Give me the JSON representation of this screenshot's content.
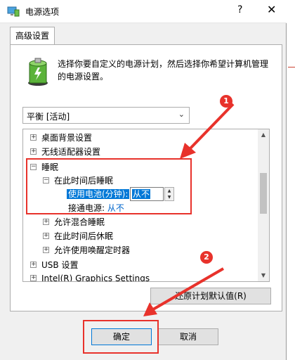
{
  "window": {
    "title": "电源选项",
    "help_symbol": "?",
    "close_symbol": "✕",
    "tab_label": "高级设置"
  },
  "description": "选择你要自定义的电源计划，然后选择你希望计算机管理的电源设置。",
  "plan_select": {
    "value": "平衡 [活动]",
    "chevron": "⌄"
  },
  "tree": {
    "items": [
      {
        "expander": "+",
        "label": "桌面背景设置"
      },
      {
        "expander": "+",
        "label": "无线适配器设置"
      },
      {
        "expander": "−",
        "label": "睡眠"
      },
      {
        "expander": "−",
        "label": "在此时间后睡眠"
      },
      {
        "label": "使用电池(分钟):"
      },
      {
        "label": "接通电源:",
        "value": "从不"
      },
      {
        "expander": "+",
        "label": "允许混合睡眠"
      },
      {
        "expander": "+",
        "label": "在此时间后休眠"
      },
      {
        "expander": "+",
        "label": "允许使用唤醒定时器"
      },
      {
        "expander": "+",
        "label": "USB 设置"
      },
      {
        "expander": "+",
        "label": "Intel(R) Graphics Settings"
      }
    ],
    "battery_spinner_value": "从不"
  },
  "buttons": {
    "restore": "还原计划默认值(R)",
    "ok": "确定",
    "cancel": "取消"
  },
  "annotations": {
    "badge1": "1",
    "badge2": "2",
    "color": "#e8322b"
  },
  "icons": {
    "window": "power-options-icon",
    "plan": "battery-plan-icon"
  }
}
